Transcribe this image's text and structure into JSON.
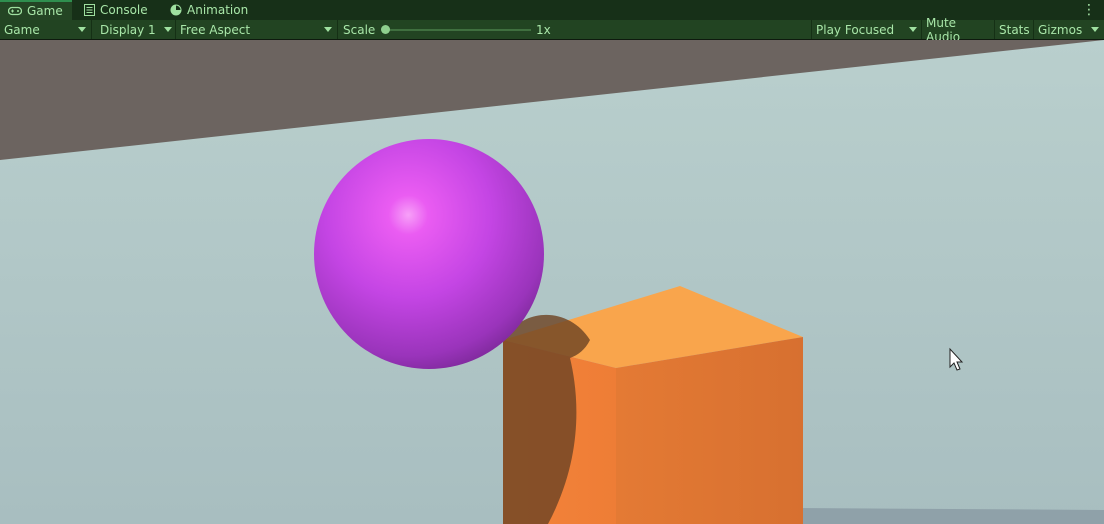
{
  "tabs": [
    {
      "label": "Game",
      "icon": "gamepad-icon",
      "active": true
    },
    {
      "label": "Console",
      "icon": "console-icon",
      "active": false
    },
    {
      "label": "Animation",
      "icon": "animation-clock-icon",
      "active": false
    }
  ],
  "toolbar": {
    "view_mode": "Game",
    "display": "Display 1",
    "aspect": "Free Aspect",
    "scale_label": "Scale",
    "scale_value": "1x",
    "scale_level": 0.0,
    "play_mode": "Play Focused",
    "mute_audio": "Mute Audio",
    "stats": "Stats",
    "gizmos": "Gizmos"
  },
  "colors": {
    "accent": "#2f8f4f",
    "sky": "#b4cac8",
    "backdrop": "#6c6460",
    "sphere": "#c04ae0",
    "cube": "#f4873a"
  }
}
